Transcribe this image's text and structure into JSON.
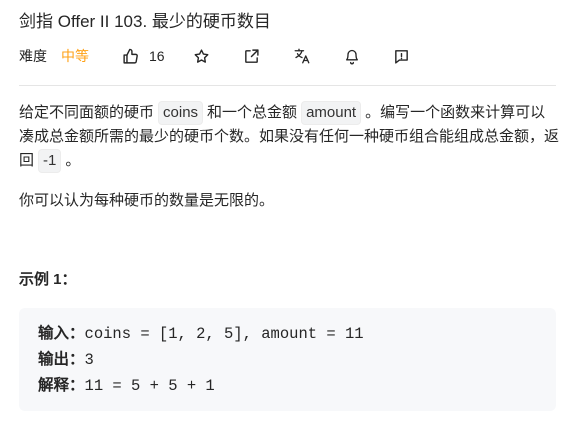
{
  "problem": {
    "title": "剑指 Offer II 103. 最少的硬币数目",
    "difficulty_label": "难度",
    "difficulty": "中等",
    "likes": "16",
    "accent_color": "#ffa116"
  },
  "icons": [
    "thumbs-up-icon",
    "star-icon",
    "share-icon",
    "translate-icon",
    "bell-icon",
    "feedback-icon"
  ],
  "description": {
    "p1_a": "给定不同面额的硬币",
    "code_coins": "coins",
    "p1_b": "和一个总金额",
    "code_amount": "amount",
    "p1_c": "。编写一个函数来计算可以凑成总金额所需的最少的硬币个数。如果没有任何一种硬币组合能组成总金额，返回",
    "code_neg1": "-1",
    "p1_d": "。",
    "p2": "你可以认为每种硬币的数量是无限的。"
  },
  "example": {
    "title": "示例 1：",
    "input_label": "输入：",
    "input_value": "coins = [1, 2, 5], amount = 11",
    "output_label": "输出：",
    "output_value": "3",
    "explain_label": "解释：",
    "explain_value": "11 = 5 + 5 + 1"
  }
}
